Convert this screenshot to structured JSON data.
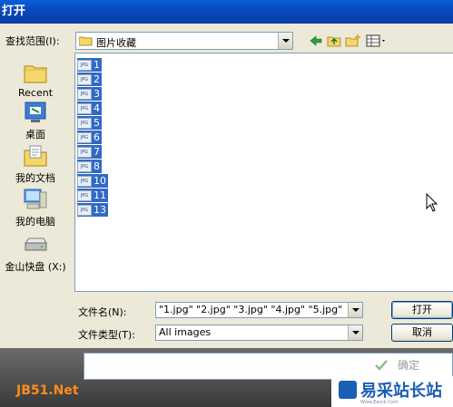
{
  "window": {
    "title": "打开"
  },
  "look_in": {
    "label": "查找范围(I):",
    "value": "图片收藏"
  },
  "toolbar_icons": [
    "back-arrow-icon",
    "up-folder-icon",
    "new-folder-icon",
    "view-menu-icon"
  ],
  "places": [
    {
      "label": "Recent",
      "icon": "recent-folder-icon"
    },
    {
      "label": "桌面",
      "icon": "desktop-icon"
    },
    {
      "label": "我的文档",
      "icon": "my-documents-icon"
    },
    {
      "label": "我的电脑",
      "icon": "my-computer-icon"
    },
    {
      "label": "金山快盘 (X:)",
      "icon": "drive-icon"
    }
  ],
  "files": [
    {
      "name": "1",
      "icon_text": "JPG"
    },
    {
      "name": "2",
      "icon_text": "JPG"
    },
    {
      "name": "3",
      "icon_text": "JPG"
    },
    {
      "name": "4",
      "icon_text": "JPG"
    },
    {
      "name": "5",
      "icon_text": "JPG"
    },
    {
      "name": "6",
      "icon_text": "JPG"
    },
    {
      "name": "7",
      "icon_text": "JPG"
    },
    {
      "name": "8",
      "icon_text": "JPG"
    },
    {
      "name": "10",
      "icon_text": "JPG"
    },
    {
      "name": "11",
      "icon_text": "JPG"
    },
    {
      "name": "13",
      "icon_text": "JPG"
    }
  ],
  "filename": {
    "label": "文件名(N):",
    "value": "\"1.jpg\" \"2.jpg\" \"3.jpg\" \"4.jpg\" \"5.jpg\""
  },
  "filetype": {
    "label": "文件类型(T):",
    "value": "All images"
  },
  "buttons": {
    "open": "打开",
    "cancel": "取消",
    "ok": "确定"
  },
  "watermarks": {
    "left": "JB51.Net",
    "right": "易采站长站",
    "right_url": "Www.Easck.Com"
  },
  "colors": {
    "selection": "#316ac5",
    "titlebar": "#0846b6"
  }
}
